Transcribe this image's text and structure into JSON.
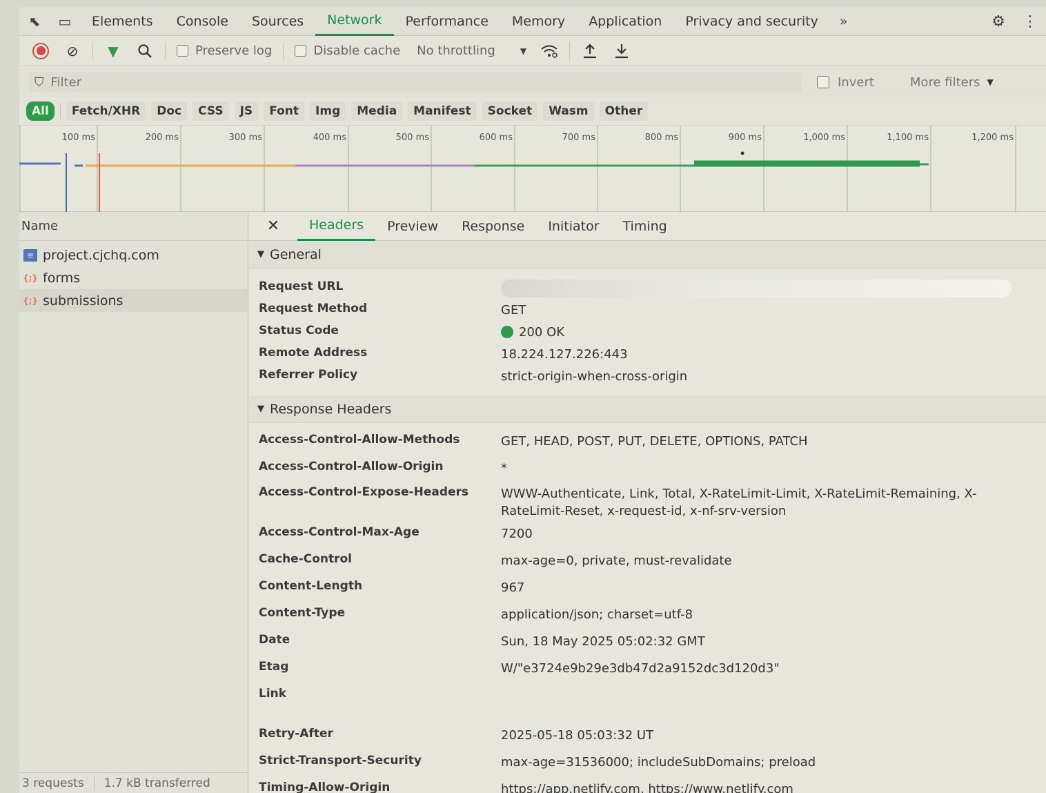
{
  "tabbar": {
    "tabs": [
      "Elements",
      "Console",
      "Sources",
      "Network",
      "Performance",
      "Memory",
      "Application",
      "Privacy and security"
    ],
    "active_tab": "Network",
    "more": "»"
  },
  "toolbar": {
    "preserve_log": "Preserve log",
    "disable_cache": "Disable cache",
    "throttling": "No throttling"
  },
  "filter": {
    "placeholder": "Filter",
    "invert": "Invert",
    "more_filters": "More filters"
  },
  "type_filters": [
    "All",
    "Fetch/XHR",
    "Doc",
    "CSS",
    "JS",
    "Font",
    "Img",
    "Media",
    "Manifest",
    "Socket",
    "Wasm",
    "Other"
  ],
  "timeline": {
    "ticks": [
      "100 ms",
      "200 ms",
      "300 ms",
      "400 ms",
      "500 ms",
      "600 ms",
      "700 ms",
      "800 ms",
      "900 ms",
      "1,000 ms",
      "1,100 ms",
      "1,200 ms"
    ]
  },
  "requests": {
    "header": "Name",
    "items": [
      {
        "name": "project.cjchq.com",
        "type": "doc"
      },
      {
        "name": "forms",
        "type": "xhr"
      },
      {
        "name": "submissions",
        "type": "xhr"
      }
    ],
    "summary": {
      "count": "3 requests",
      "transferred": "1.7 kB transferred"
    }
  },
  "detail_tabs": [
    "Headers",
    "Preview",
    "Response",
    "Initiator",
    "Timing"
  ],
  "active_detail_tab": "Headers",
  "general": {
    "title": "General",
    "rows": [
      {
        "key": "Request URL",
        "value": ""
      },
      {
        "key": "Request Method",
        "value": "GET"
      },
      {
        "key": "Status Code",
        "value": "200 OK"
      },
      {
        "key": "Remote Address",
        "value": "18.224.127.226:443"
      },
      {
        "key": "Referrer Policy",
        "value": "strict-origin-when-cross-origin"
      }
    ]
  },
  "response_headers": {
    "title": "Response Headers",
    "rows": [
      {
        "key": "Access-Control-Allow-Methods",
        "value": "GET, HEAD, POST, PUT, DELETE, OPTIONS, PATCH"
      },
      {
        "key": "Access-Control-Allow-Origin",
        "value": "*"
      },
      {
        "key": "Access-Control-Expose-Headers",
        "value": "WWW-Authenticate, Link, Total, X-RateLimit-Limit, X-RateLimit-Remaining, X-RateLimit-Reset, x-request-id, x-nf-srv-version"
      },
      {
        "key": "Access-Control-Max-Age",
        "value": "7200"
      },
      {
        "key": "Cache-Control",
        "value": "max-age=0, private, must-revalidate"
      },
      {
        "key": "Content-Length",
        "value": "967"
      },
      {
        "key": "Content-Type",
        "value": "application/json; charset=utf-8"
      },
      {
        "key": "Date",
        "value": "Sun, 18 May 2025 05:02:32 GMT"
      },
      {
        "key": "Etag",
        "value": "W/\"e3724e9b29e3db47d2a9152dc3d120d3\""
      },
      {
        "key": "Link",
        "value": ""
      },
      {
        "key": "Retry-After",
        "value": "2025-05-18 05:03:32 UT"
      },
      {
        "key": "Strict-Transport-Security",
        "value": "max-age=31536000; includeSubDomains; preload"
      },
      {
        "key": "Timing-Allow-Origin",
        "value": "https://app.netlify.com, https://www.netlify.com"
      }
    ]
  },
  "colors": {
    "accent": "#1a8f4e",
    "status_ok": "#2e9a4c",
    "record": "#d24a45"
  }
}
